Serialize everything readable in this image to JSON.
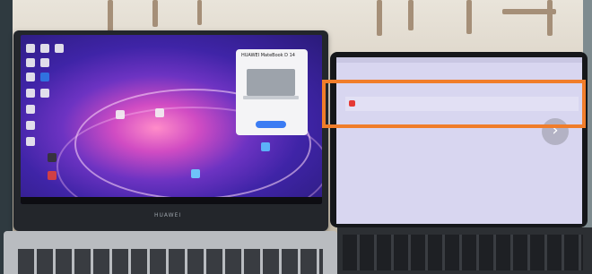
{
  "laptop": {
    "brand": "HUAWEI",
    "popup_title": "HUAWEI MateBook D 14"
  },
  "highlight": {
    "color": "#f07d2a"
  }
}
